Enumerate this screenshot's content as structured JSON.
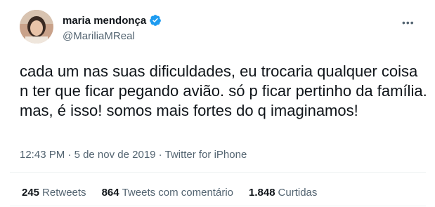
{
  "author": {
    "display_name": "maria mendonça",
    "handle": "@MariliaMReal",
    "verified_icon": "verified-badge-icon"
  },
  "tweet": {
    "text": "cada um nas suas dificuldades, eu trocaria qualquer coisa n ter que ficar pegando avião. só p ficar pertinho da família. mas, é isso! somos mais fortes do q imaginamos!",
    "time": "12:43 PM",
    "separator": "·",
    "date": "5 de nov de 2019",
    "source": "Twitter for iPhone"
  },
  "stats": {
    "retweets": {
      "count": "245",
      "label": "Retweets"
    },
    "quotes": {
      "count": "864",
      "label": "Tweets com comentário"
    },
    "likes": {
      "count": "1.848",
      "label": "Curtidas"
    }
  },
  "colors": {
    "verified": "#1d9bf0",
    "text": "#0f1419",
    "secondary": "#536471",
    "divider": "#eff3f4"
  },
  "icons": {
    "more": "more-dots-icon",
    "avatar": "avatar"
  },
  "more_glyph": "•••"
}
